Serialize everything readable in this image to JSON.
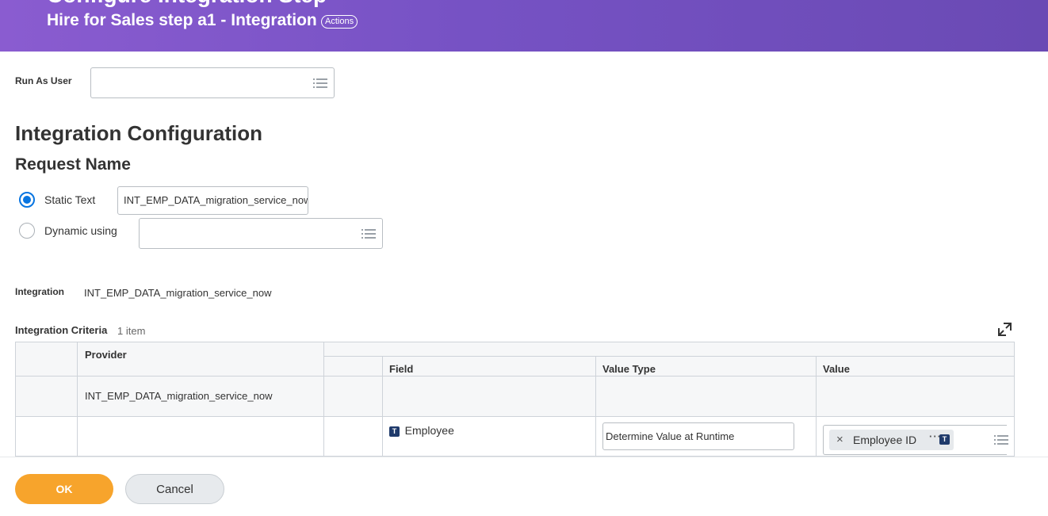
{
  "header": {
    "title": "Configure Integration Step",
    "subtitle": "Hire for Sales step a1 - Integration",
    "actions_label": "Actions",
    "gradient_start": "#8a5cd0",
    "gradient_end": "#6a4ab4"
  },
  "run_as_user": {
    "label": "Run As User",
    "value": ""
  },
  "integration_configuration": {
    "heading": "Integration Configuration",
    "request_name_heading": "Request Name",
    "options": [
      {
        "label": "Static Text",
        "selected": true,
        "value": "INT_EMP_DATA_migration_service_now"
      },
      {
        "label": "Dynamic using",
        "selected": false,
        "value": ""
      }
    ]
  },
  "integration": {
    "label": "Integration",
    "value": "INT_EMP_DATA_migration_service_now"
  },
  "criteria": {
    "label": "Integration Criteria",
    "count": "1 item",
    "columns": {
      "provider": "Provider",
      "field": "Field",
      "value_type": "Value Type",
      "value": "Value"
    },
    "rows": [
      {
        "provider": "INT_EMP_DATA_migration_service_now",
        "field": "",
        "value_type": "",
        "value": ""
      },
      {
        "provider": "",
        "field": "Employee",
        "field_icon": "T",
        "value_type": "Determine Value at Runtime",
        "value": "Employee ID",
        "value_icon": "T"
      }
    ]
  },
  "footer": {
    "ok_label": "OK",
    "cancel_label": "Cancel",
    "ok_color": "#f7a42c"
  }
}
